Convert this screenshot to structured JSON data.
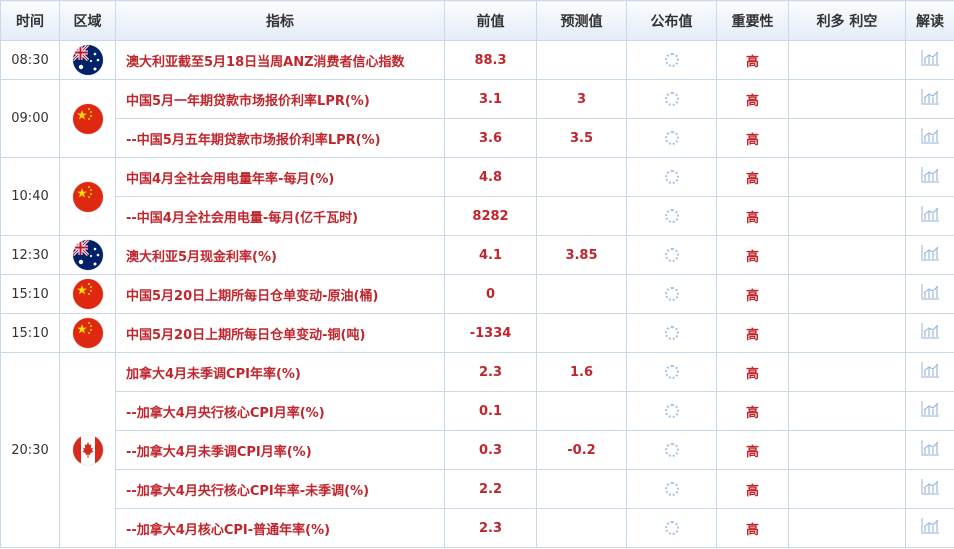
{
  "header": {
    "time": "时间",
    "region": "区域",
    "indicator": "指标",
    "previous": "前值",
    "forecast": "预测值",
    "actual": "公布值",
    "importance": "重要性",
    "impact": "利多 利空",
    "analysis": "解读"
  },
  "groups": [
    {
      "time": "08:30",
      "flag": "australia-flag",
      "rows": [
        {
          "indicator": "澳大利亚截至5月18日当周ANZ消费者信心指数",
          "previous": "88.3",
          "forecast": "",
          "importance": "高"
        }
      ]
    },
    {
      "time": "09:00",
      "flag": "china-flag",
      "rows": [
        {
          "indicator": "中国5月一年期贷款市场报价利率LPR(%)",
          "previous": "3.1",
          "forecast": "3",
          "importance": "高"
        },
        {
          "indicator": "--中国5月五年期贷款市场报价利率LPR(%)",
          "previous": "3.6",
          "forecast": "3.5",
          "importance": "高"
        }
      ]
    },
    {
      "time": "10:40",
      "flag": "china-flag",
      "rows": [
        {
          "indicator": "中国4月全社会用电量年率-每月(%)",
          "previous": "4.8",
          "forecast": "",
          "importance": "高"
        },
        {
          "indicator": "--中国4月全社会用电量-每月(亿千瓦时)",
          "previous": "8282",
          "forecast": "",
          "importance": "高"
        }
      ]
    },
    {
      "time": "12:30",
      "flag": "australia-flag",
      "rows": [
        {
          "indicator": "澳大利亚5月现金利率(%)",
          "previous": "4.1",
          "forecast": "3.85",
          "importance": "高"
        }
      ]
    },
    {
      "time": "15:10",
      "flag": "china-flag",
      "rows": [
        {
          "indicator": "中国5月20日上期所每日仓单变动-原油(桶)",
          "previous": "0",
          "forecast": "",
          "importance": "高"
        }
      ]
    },
    {
      "time": "15:10",
      "flag": "china-flag",
      "rows": [
        {
          "indicator": "中国5月20日上期所每日仓单变动-铜(吨)",
          "previous": "-1334",
          "forecast": "",
          "importance": "高"
        }
      ]
    },
    {
      "time": "20:30",
      "flag": "canada-flag",
      "rows": [
        {
          "indicator": "加拿大4月未季调CPI年率(%)",
          "previous": "2.3",
          "forecast": "1.6",
          "importance": "高"
        },
        {
          "indicator": "--加拿大4月央行核心CPI月率(%)",
          "previous": "0.1",
          "forecast": "",
          "importance": "高"
        },
        {
          "indicator": "--加拿大4月未季调CPI月率(%)",
          "previous": "0.3",
          "forecast": "-0.2",
          "importance": "高"
        },
        {
          "indicator": "--加拿大4月央行核心CPI年率-未季调(%)",
          "previous": "2.2",
          "forecast": "",
          "importance": "高"
        },
        {
          "indicator": "--加拿大4月核心CPI-普通年率(%)",
          "previous": "2.3",
          "forecast": "",
          "importance": "高"
        }
      ]
    }
  ],
  "icons": {
    "actual_pending": "loading-spinner-icon",
    "analysis": "chart-icon"
  },
  "colors": {
    "value_text": "#c0262d",
    "header_bg": "#e4ecf7",
    "border": "#c9d9ec"
  }
}
